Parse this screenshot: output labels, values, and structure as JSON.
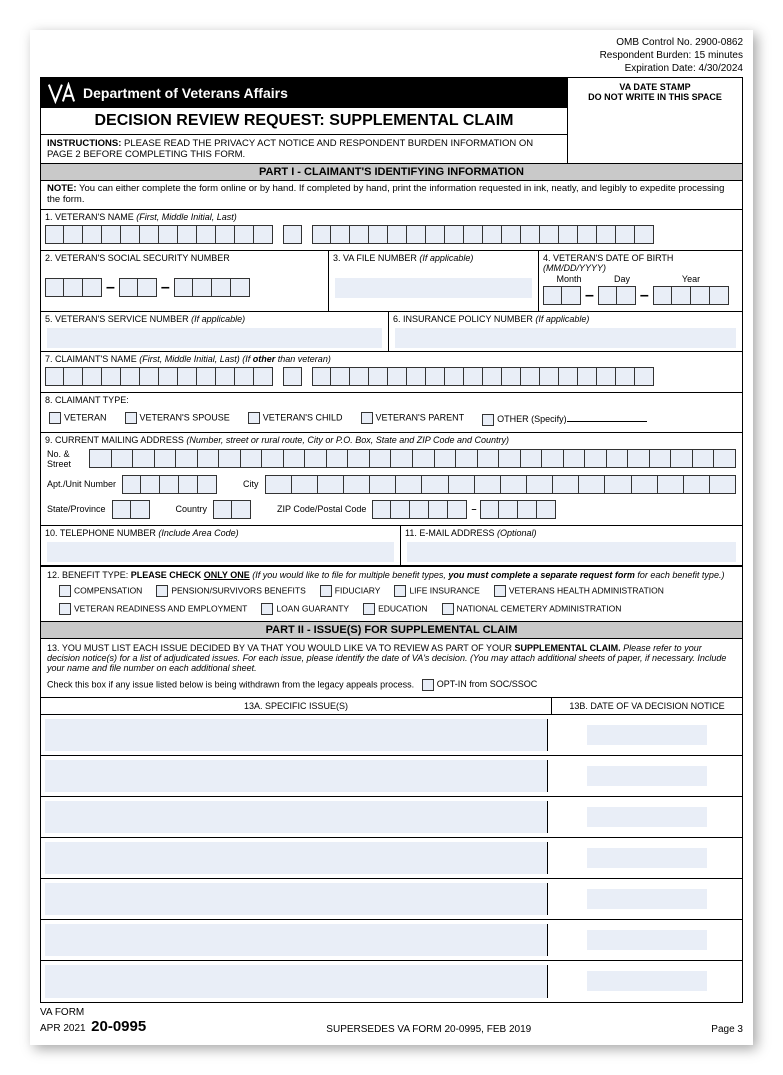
{
  "omb": {
    "control": "OMB Control No. 2900-0862",
    "burden": "Respondent Burden: 15 minutes",
    "expiration": "Expiration Date: 4/30/2024"
  },
  "stamp": {
    "l1": "VA DATE STAMP",
    "l2": "DO NOT WRITE IN THIS SPACE"
  },
  "dept": "Department of Veterans Affairs",
  "title": "DECISION REVIEW REQUEST:  SUPPLEMENTAL CLAIM",
  "instructions_label": "INSTRUCTIONS:",
  "instructions_text": " PLEASE READ THE PRIVACY ACT NOTICE AND RESPONDENT BURDEN INFORMATION ON PAGE 2 BEFORE COMPLETING THIS FORM.",
  "part1_header": "PART I - CLAIMANT'S IDENTIFYING INFORMATION",
  "note_label": "NOTE:",
  "note_text": " You can either complete the form online or by hand.  If completed by hand, print the information requested in ink, neatly, and legibly to expedite processing the form.",
  "fields": {
    "f1": "1. VETERAN'S NAME ",
    "f1h": "(First, Middle Initial, Last)",
    "f2": "2. VETERAN'S SOCIAL SECURITY NUMBER",
    "f3": "3. VA FILE NUMBER ",
    "f3h": "(If applicable)",
    "f4": "4. VETERAN'S DATE OF BIRTH ",
    "f4h": "(MM/DD/YYYY)",
    "f4m": "Month",
    "f4d": "Day",
    "f4y": "Year",
    "f5": "5. VETERAN'S SERVICE NUMBER ",
    "f5h": "(If applicable)",
    "f6": "6. INSURANCE POLICY NUMBER ",
    "f6h": "(If applicable)",
    "f7": "7. CLAIMANT'S NAME ",
    "f7h": "(First, Middle Initial, Last)",
    "f7h2": " (If ",
    "f7b": "other",
    "f7h3": " than veteran)",
    "f8": "8. CLAIMANT TYPE:",
    "c8a": "VETERAN",
    "c8b": "VETERAN'S SPOUSE",
    "c8c": "VETERAN'S CHILD",
    "c8d": "VETERAN'S PARENT",
    "c8e": "OTHER ",
    "c8eh": "(Specify)",
    "f9": "9. CURRENT MAILING ADDRESS ",
    "f9h": "(Number, street or rural route, City or P.O. Box, State and ZIP Code and Country)",
    "a_no": "No. & Street",
    "a_apt": "Apt./Unit Number",
    "a_city": "City",
    "a_state": "State/Province",
    "a_country": "Country",
    "a_zip": "ZIP Code/Postal Code",
    "f10": "10. TELEPHONE NUMBER ",
    "f10h": "(Include Area Code)",
    "f11": "11. E-MAIL ADDRESS ",
    "f11h": "(Optional)",
    "f12a": "12. BENEFIT TYPE:  ",
    "f12b": "PLEASE CHECK ",
    "f12u": "ONLY ONE",
    "f12h": " (If you would like to file for multiple benefit types, ",
    "f12h2": "you must complete a separate request form",
    "f12h3": " for each benefit type.)",
    "b1": "COMPENSATION",
    "b2": "PENSION/SURVIVORS BENEFITS",
    "b3": "FIDUCIARY",
    "b4": "LIFE INSURANCE",
    "b5": "VETERANS HEALTH ADMINISTRATION",
    "b6": "VETERAN READINESS AND EMPLOYMENT",
    "b7": "LOAN GUARANTY",
    "b8": "EDUCATION",
    "b9": "NATIONAL CEMETERY ADMINISTRATION"
  },
  "part2_header": "PART II - ISSUE(S) FOR SUPPLEMENTAL CLAIM",
  "p2": {
    "t1": "13.  YOU MUST LIST EACH ISSUE DECIDED BY VA THAT YOU WOULD LIKE VA TO REVIEW AS PART OF YOUR ",
    "tb": "SUPPLEMENTAL CLAIM.",
    "t2": "  Please refer to your decision notice(s) for a list of adjudicated issues.  For each issue, please identify the date of VA's decision. (You may attach additional sheets of paper, if necessary. Include your name and file number on each additional sheet.",
    "optin_text": "Check this box if any issue listed below is being withdrawn from the legacy appeals process.",
    "optin_label": "OPT-IN from SOC/SSOC",
    "col1": "13A.  SPECIFIC ISSUE(S)",
    "col2": "13B.  DATE OF VA DECISION NOTICE"
  },
  "footer": {
    "l1": "VA FORM",
    "l2": "APR 2021",
    "num": "20-0995",
    "supersedes": "SUPERSEDES VA FORM 20-0995, FEB 2019",
    "page": "Page 3"
  }
}
